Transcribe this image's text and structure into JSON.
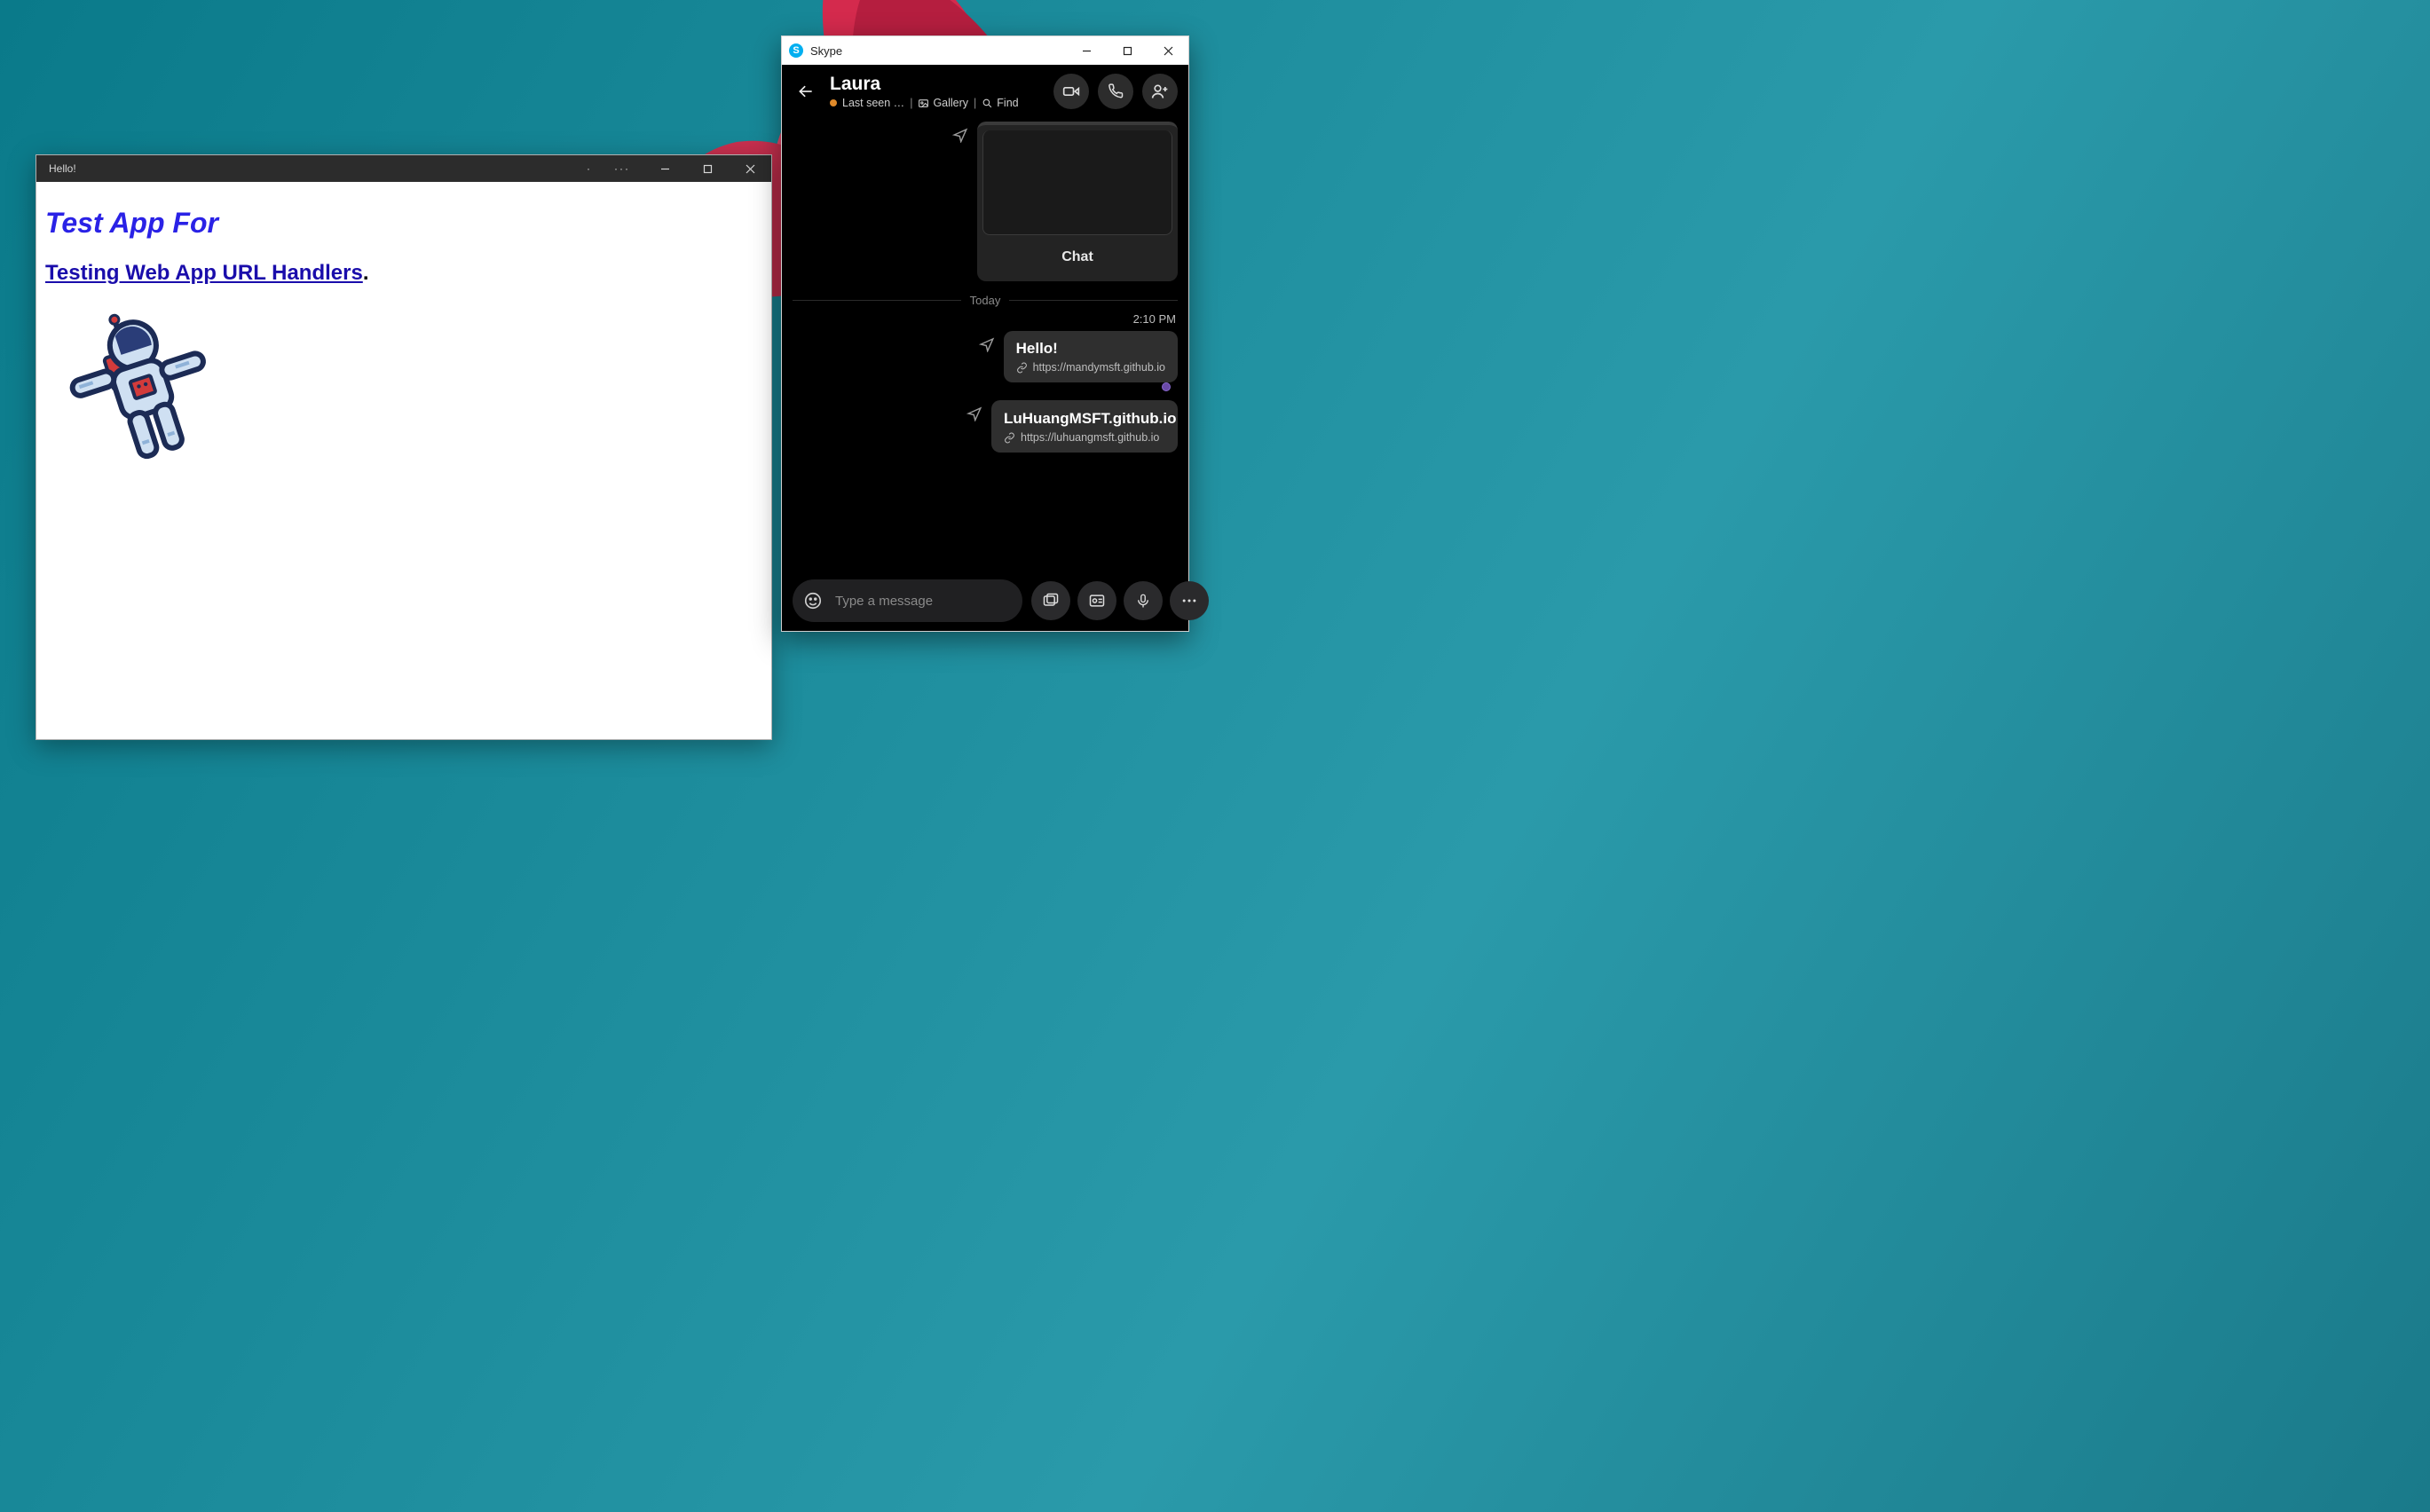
{
  "pwa": {
    "title": "Hello!",
    "heading": "Test App For",
    "link_text": "Testing Web App URL Handlers",
    "dot": "."
  },
  "skype": {
    "app_name": "Skype",
    "contact": {
      "name": "Laura",
      "last_seen": "Last seen …",
      "gallery": "Gallery",
      "find": "Find"
    },
    "preview_label": "Chat",
    "date_separator": "Today",
    "time": "2:10 PM",
    "messages": [
      {
        "title": "Hello!",
        "url": "https://mandymsft.github.io"
      },
      {
        "title": "LuHuangMSFT.github.io",
        "url": "https://luhuangmsft.github.io"
      }
    ],
    "composer_placeholder": "Type a message"
  }
}
